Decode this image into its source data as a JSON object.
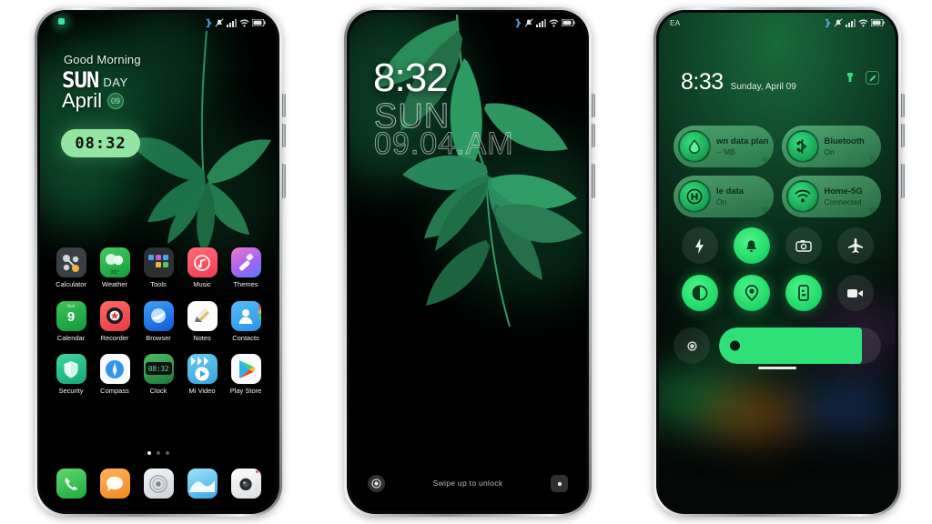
{
  "scene": {
    "title": "MIUI green leaf theme preview - three phone mockups",
    "background": "#ffffff",
    "accent": "#2fe078"
  },
  "statusbar": {
    "icons": [
      "bluetooth-icon",
      "mute-icon",
      "signal-icon",
      "wifi-icon",
      "battery-icon"
    ],
    "carrier_phone3": "EA"
  },
  "phone1": {
    "name": "home-screen",
    "greeting": "Good Morning",
    "weekday": "SUN",
    "day_word": "DAY",
    "month": "April",
    "date_num": "09",
    "clock": "08:32",
    "apps_row1": [
      {
        "label": "Calculator",
        "icon": "calculator-icon"
      },
      {
        "label": "Weather",
        "icon": "weather-icon",
        "badge": "31°"
      },
      {
        "label": "Tools",
        "icon": "tools-folder-icon"
      },
      {
        "label": "Music",
        "icon": "music-icon"
      },
      {
        "label": "Themes",
        "icon": "themes-icon"
      }
    ],
    "apps_row2": [
      {
        "label": "Calendar",
        "icon": "calendar-icon",
        "badge_top": "Sun",
        "badge": "9"
      },
      {
        "label": "Recorder",
        "icon": "recorder-icon"
      },
      {
        "label": "Browser",
        "icon": "browser-icon"
      },
      {
        "label": "Notes",
        "icon": "notes-icon"
      },
      {
        "label": "Contacts",
        "icon": "contacts-icon"
      }
    ],
    "apps_row3": [
      {
        "label": "Security",
        "icon": "security-shield-icon"
      },
      {
        "label": "Compass",
        "icon": "compass-icon"
      },
      {
        "label": "Clock",
        "icon": "clock-icon",
        "badge": "08:32"
      },
      {
        "label": "Mi Video",
        "icon": "mi-video-icon"
      },
      {
        "label": "Play Store",
        "icon": "play-store-icon"
      }
    ],
    "dock": [
      {
        "label": "Phone",
        "icon": "phone-icon"
      },
      {
        "label": "Messages",
        "icon": "messages-icon"
      },
      {
        "label": "Settings",
        "icon": "settings-icon"
      },
      {
        "label": "Gallery",
        "icon": "gallery-icon"
      },
      {
        "label": "Camera",
        "icon": "camera-icon"
      }
    ],
    "page_dots": {
      "count": 3,
      "active": 0
    }
  },
  "phone2": {
    "name": "lock-screen",
    "clock": "8:32",
    "weekday": "SUN",
    "datetime": "09.04.AM",
    "hint": "Swipe up to unlock",
    "left_button": "voice-assistant-icon",
    "right_button": "camera-icon"
  },
  "phone3": {
    "name": "control-center",
    "clock": "8:33",
    "date": "Sunday, April 09",
    "header_icons": [
      "flashlight-icon",
      "edit-icon"
    ],
    "tiles": [
      {
        "title": "wn data plan",
        "subtitle": "-- MB",
        "icon": "data-plan-icon",
        "state": "on"
      },
      {
        "title": "Bluetooth",
        "subtitle": "On",
        "icon": "bluetooth-icon",
        "state": "on"
      },
      {
        "title": "le data",
        "subtitle": "On",
        "icon": "mobile-data-icon",
        "state": "on"
      },
      {
        "title": "Home-5G",
        "subtitle": "Connected",
        "icon": "wifi-icon",
        "state": "on"
      }
    ],
    "toggles": [
      {
        "name": "flashlight-toggle",
        "icon": "flashlight-icon",
        "state": "off"
      },
      {
        "name": "ring-toggle",
        "icon": "bell-icon",
        "state": "on"
      },
      {
        "name": "screenshot-toggle",
        "icon": "screenshot-icon",
        "state": "off"
      },
      {
        "name": "airplane-toggle",
        "icon": "airplane-icon",
        "state": "off"
      },
      {
        "name": "dark-mode-toggle",
        "icon": "contrast-icon",
        "state": "on"
      },
      {
        "name": "location-toggle",
        "icon": "location-icon",
        "state": "on"
      },
      {
        "name": "cast-toggle",
        "icon": "cast-phone-icon",
        "state": "on"
      },
      {
        "name": "screen-record-toggle",
        "icon": "video-camera-icon",
        "state": "off"
      }
    ],
    "slider": {
      "name": "brightness-slider",
      "icon": "brightness-icon",
      "percent": 88
    }
  }
}
